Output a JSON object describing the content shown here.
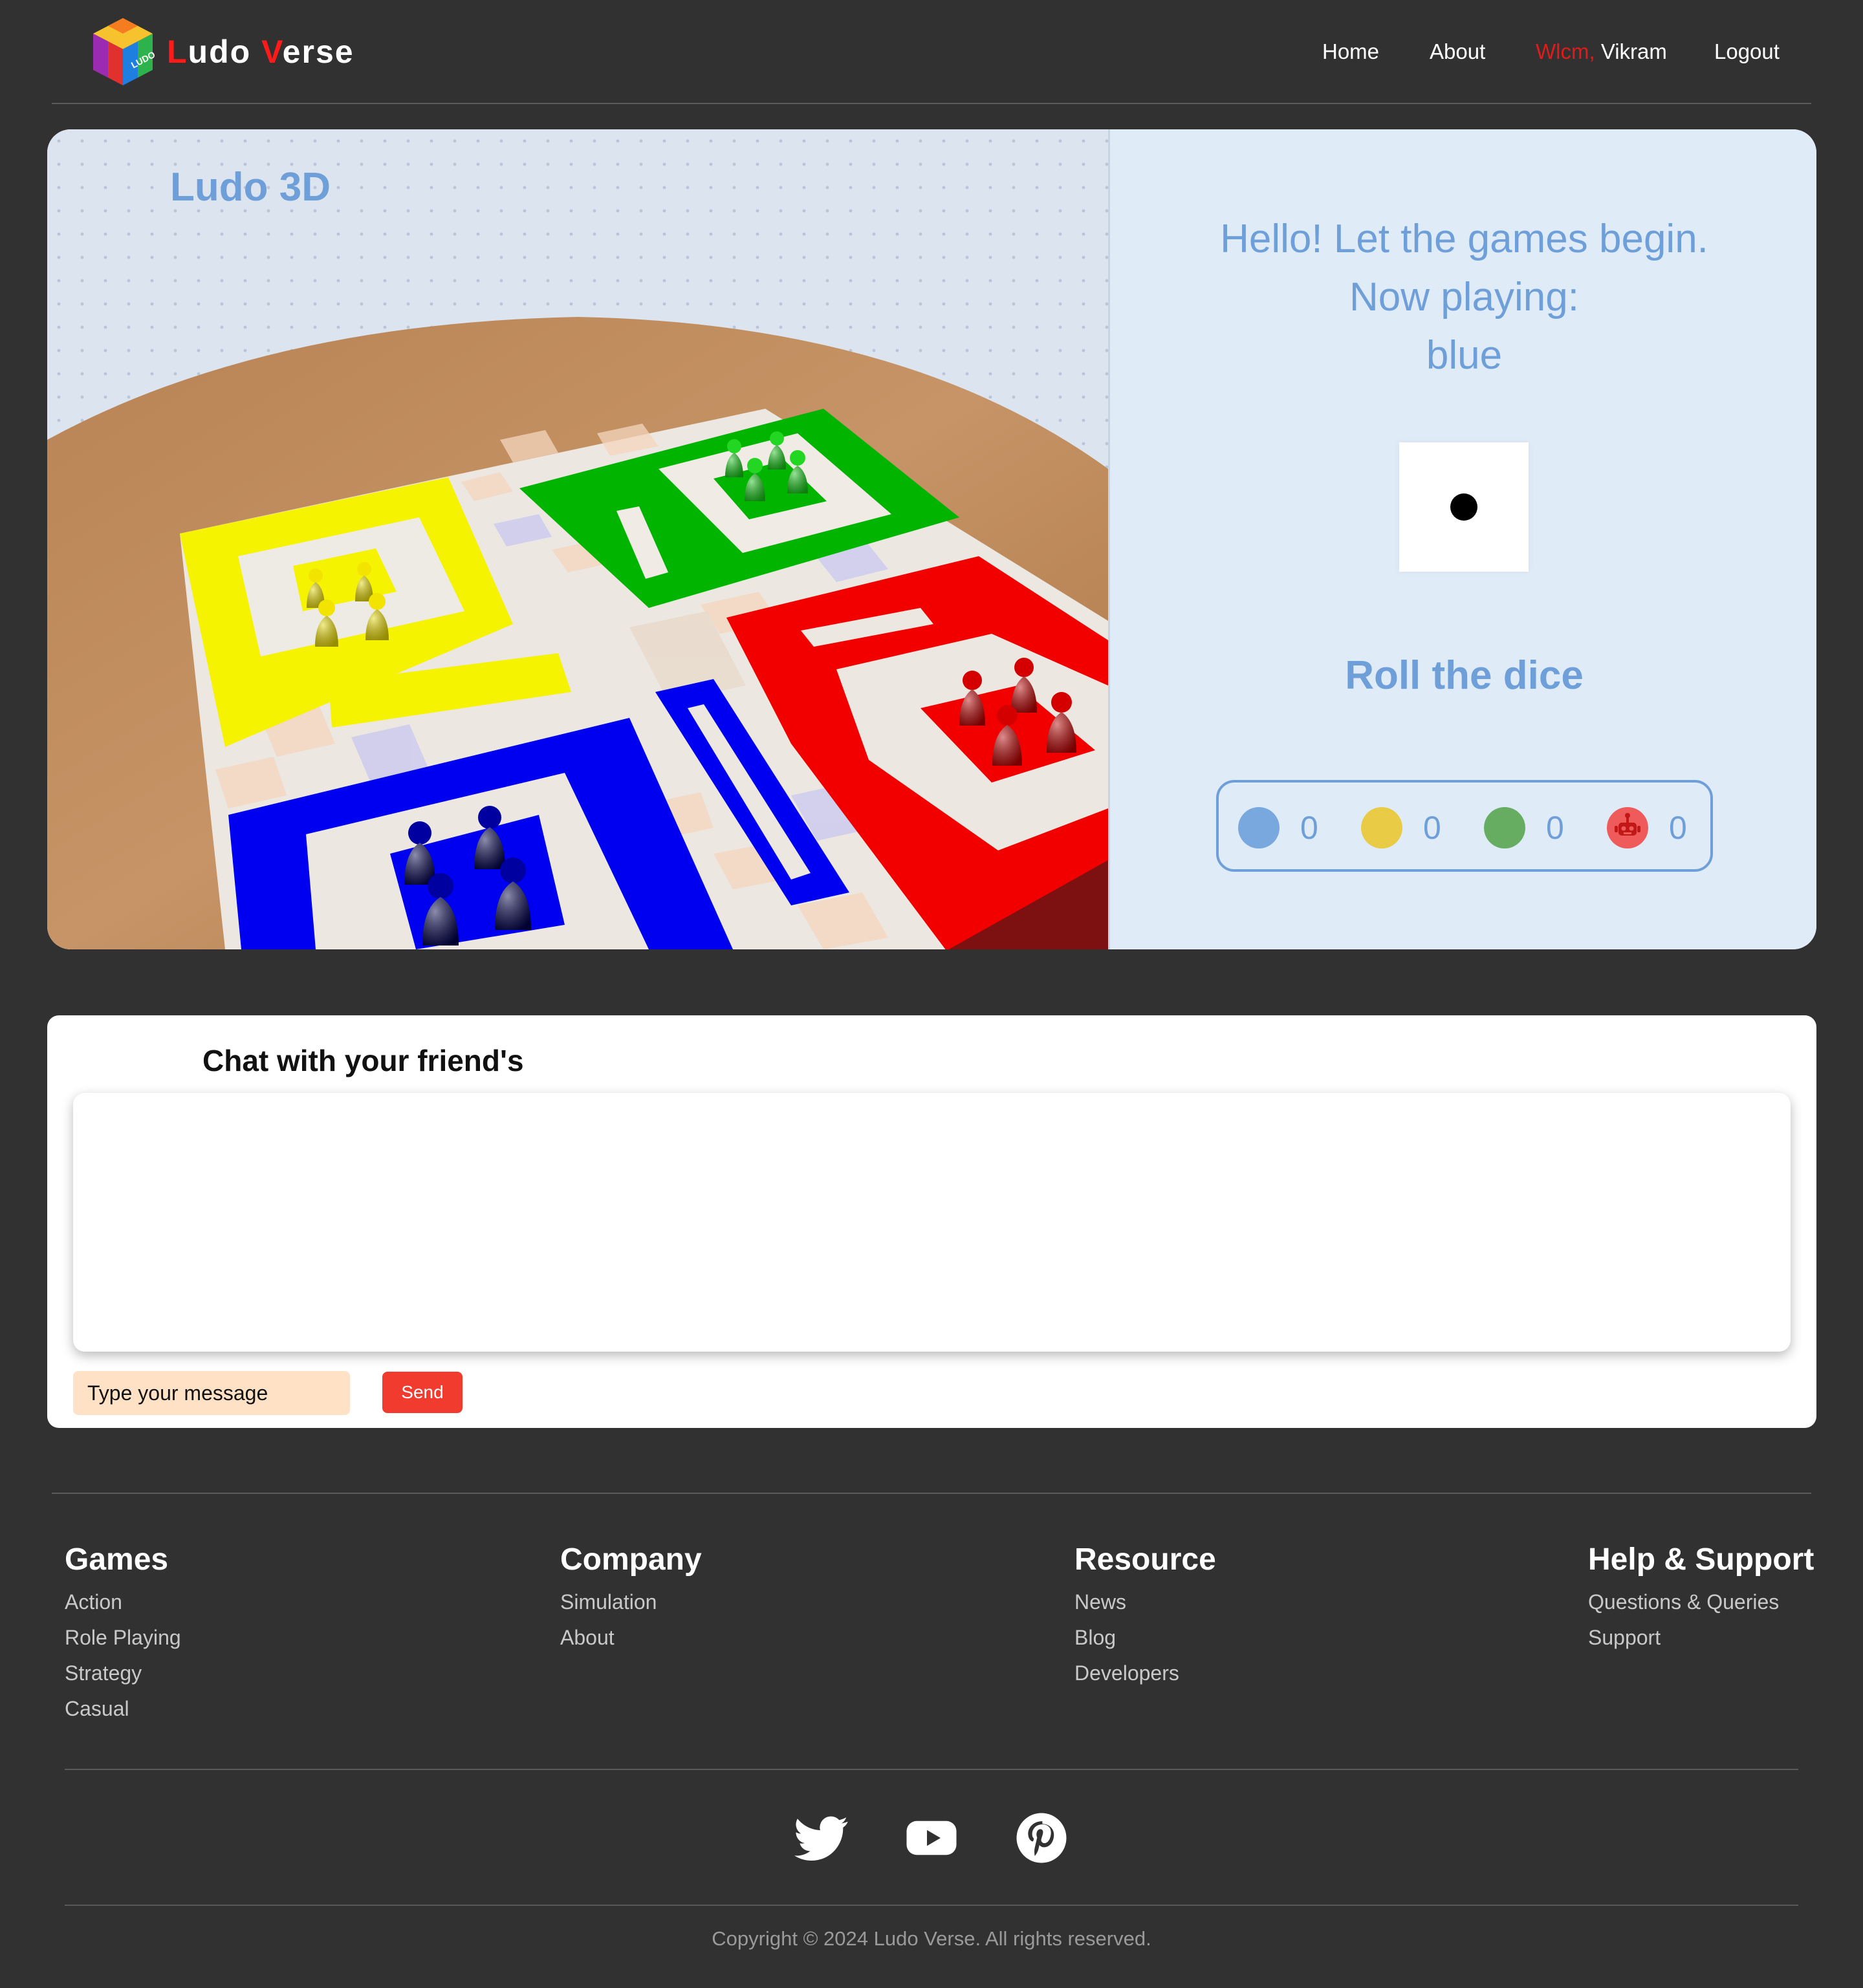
{
  "header": {
    "brand": {
      "first_initial": "L",
      "first_rest": "udo ",
      "second_initial": "V",
      "second_rest": "erse"
    },
    "logo_text": "LUDO",
    "nav": {
      "home": "Home",
      "about": "About",
      "greeting": "Wlcm,",
      "username": "Vikram",
      "logout": "Logout"
    }
  },
  "game": {
    "title": "Ludo 3D",
    "message_line1": "Hello! Let the games begin.",
    "message_line2": "Now playing:",
    "current_player": "blue",
    "dice_value": 1,
    "roll_label": "Roll the dice",
    "scores": [
      {
        "player": "blue",
        "color": "#79a8df",
        "value": "0",
        "icon": "blue-player-dot"
      },
      {
        "player": "yellow",
        "color": "#e9cb45",
        "value": "0",
        "icon": "yellow-player-dot"
      },
      {
        "player": "green",
        "color": "#66ad62",
        "value": "0",
        "icon": "green-player-dot"
      },
      {
        "player": "red",
        "color": "#ef5a5a",
        "value": "0",
        "icon": "robot-icon"
      }
    ]
  },
  "chat": {
    "title": "Chat with your friend's",
    "input_placeholder": "Type your message",
    "send_label": "Send"
  },
  "footer": {
    "columns": [
      {
        "heading": "Games",
        "links": [
          "Action",
          "Role Playing",
          "Strategy",
          "Casual"
        ]
      },
      {
        "heading": "Company",
        "links": [
          "Simulation",
          "About"
        ]
      },
      {
        "heading": "Resource",
        "links": [
          "News",
          "Blog",
          "Developers"
        ]
      },
      {
        "heading": "Help & Support",
        "links": [
          "Questions & Queries",
          "Support"
        ]
      }
    ],
    "social": [
      "twitter-icon",
      "youtube-icon",
      "pinterest-icon"
    ],
    "copyright": "Copyright © 2024 Ludo Verse. All rights reserved."
  },
  "colors": {
    "background": "#313131",
    "accent_blue": "#6f9fd8",
    "brand_red": "#ff1a1a",
    "send_button": "#f13b2f",
    "input_bg": "#ffe1c6"
  }
}
